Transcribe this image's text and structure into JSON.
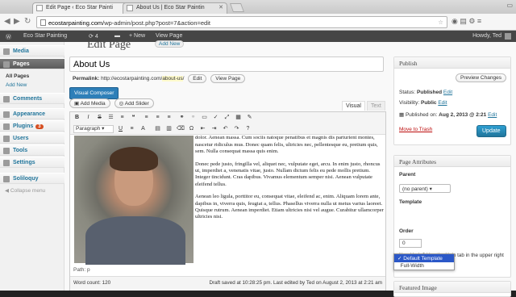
{
  "browser": {
    "tabs": [
      {
        "title": "Edit Page ‹ Eco Star Painti",
        "active": true
      },
      {
        "title": "About Us | Eco Star Paintin",
        "active": false
      }
    ],
    "url_domain": "ecostarpainting.com",
    "url_path": "/wp-admin/post.php?post=7&action=edit"
  },
  "adminbar": {
    "site_name": "Eco Star Painting",
    "updates": "4",
    "new_label": "+ New",
    "view_page": "View Page",
    "howdy": "Howdy, Ted"
  },
  "sidebar": {
    "items": [
      {
        "label": "Media"
      },
      {
        "label": "Pages"
      },
      {
        "label": "Comments"
      },
      {
        "label": "Appearance"
      },
      {
        "label": "Plugins",
        "badge": "3"
      },
      {
        "label": "Users"
      },
      {
        "label": "Tools"
      },
      {
        "label": "Settings"
      },
      {
        "label": "Soliloquy"
      }
    ],
    "sub_items": [
      "All Pages",
      "Add New"
    ],
    "collapse": "Collapse menu"
  },
  "main": {
    "heading": "Edit Page",
    "add_new": "Add New",
    "title_value": "About Us",
    "permalink_label": "Permalink:",
    "permalink_base": "http://ecostarpainting.com/",
    "permalink_slug": "about-us",
    "permalink_end": "/",
    "edit_btn": "Edit",
    "view_page_btn": "View Page",
    "visual_composer": "Visual Composer",
    "add_media": "Add Media",
    "add_slider": "Add Slider",
    "tab_visual": "Visual",
    "tab_text": "Text",
    "format_select": "Paragraph",
    "paragraphs": [
      "Lorem ipsum dolor sit amet, consectetuer adipiscing elit. Aenean commodo ligula eget dolor. Aenean massa. Cum sociis natoque penatibus et magnis dis parturient montes, nascetur ridiculus mus. Donec quam felis, ultricies nec, pellentesque eu, pretium quis, sem. Nulla consequat massa quis enim.",
      "Donec pede justo, fringilla vel, aliquet nec, vulputate eget, arcu. In enim justo, rhoncus ut, imperdiet a, venenatis vitae, justo. Nullam dictum felis eu pede mollis pretium. Integer tincidunt. Cras dapibus. Vivamus elementum semper nisi. Aenean vulputate eleifend tellus.",
      "Aenean leo ligula, porttitor eu, consequat vitae, eleifend ac, enim. Aliquam lorem ante, dapibus in, viverra quis, feugiat a, tellus. Phasellus viverra nulla ut metus varius laoreet. Quisque rutrum. Aenean imperdiet. Etiam ultricies nisi vel augue. Curabitur ullamcorper ultricies nisi."
    ],
    "path": "Path: p",
    "word_count": "Word count: 120",
    "draft_info": "Draft saved at 10:28:25 pm. Last edited by Ted on August 2, 2013 at 2:21 am"
  },
  "publish": {
    "heading": "Publish",
    "preview": "Preview Changes",
    "status_label": "Status:",
    "status_value": "Published",
    "visibility_label": "Visibility:",
    "visibility_value": "Public",
    "published_on_label": "Published on:",
    "published_on_value": "Aug 2, 2013 @ 2:21",
    "edit": "Edit",
    "trash": "Move to Trash",
    "update": "Update"
  },
  "attributes": {
    "heading": "Page Attributes",
    "parent_label": "Parent",
    "parent_value": "(no parent)",
    "template_label": "Template",
    "template_options": [
      "Default Template",
      "Full-Width"
    ],
    "template_selected": "Default Template",
    "order_label": "Order",
    "order_value": "0",
    "help": "Need help? Use the Help tab in the upper right of your screen."
  },
  "featured_image": {
    "heading": "Featured Image"
  }
}
